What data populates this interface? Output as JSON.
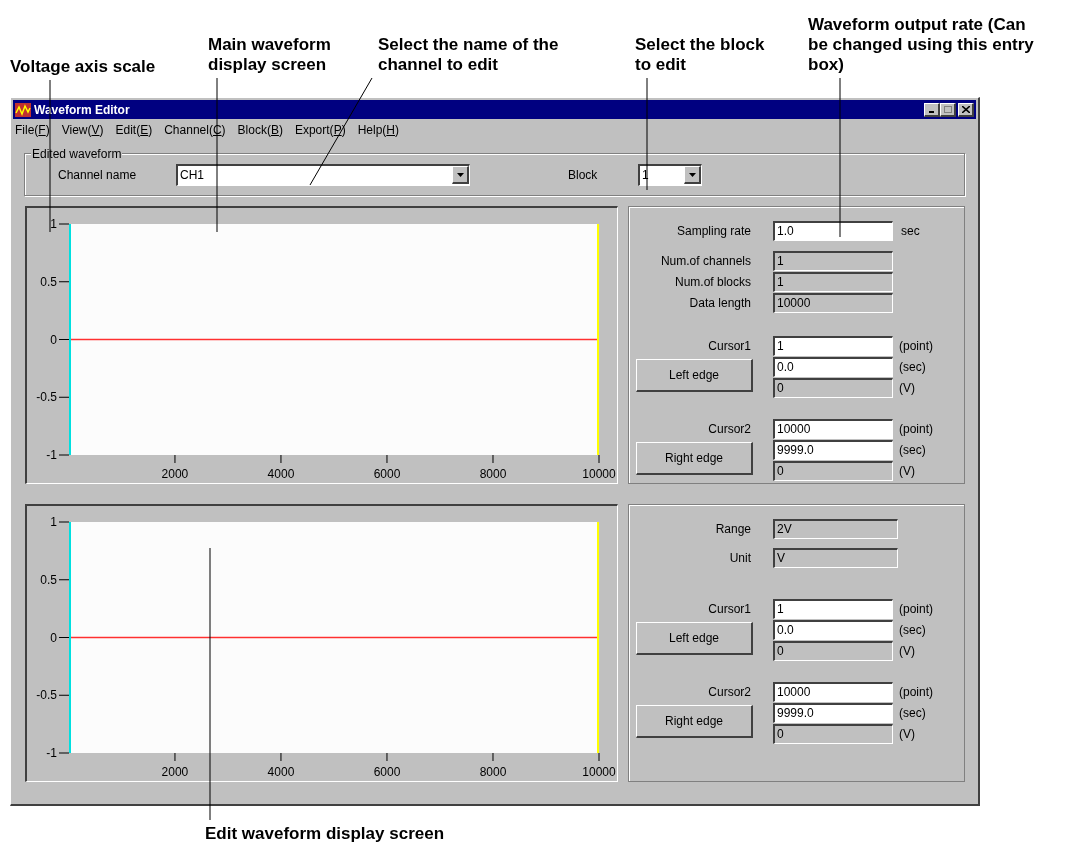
{
  "callouts": [
    {
      "text": "Voltage axis scale"
    },
    {
      "text": "Main waveform display screen"
    },
    {
      "text": "Select the name of the channel to edit"
    },
    {
      "text": "Select the block to edit"
    },
    {
      "text": "Waveform output rate (Can be changed using this entry box)"
    },
    {
      "text": "Edit waveform display screen"
    }
  ],
  "window": {
    "title": "Waveform Editor"
  },
  "menu": [
    "File(F)",
    "View(V)",
    "Edit(E)",
    "Channel(C)",
    "Block(B)",
    "Export(P)",
    "Help(H)"
  ],
  "edited_waveform": {
    "title": "Edited waveform",
    "channel_label": "Channel name",
    "channel_value": "CH1",
    "block_label": "Block",
    "block_value": "1"
  },
  "main_plot": {
    "chart_data": {
      "type": "line",
      "x": [
        1,
        10000
      ],
      "series": [
        {
          "color": "#ff3030",
          "values": [
            0,
            0
          ]
        }
      ],
      "xlim": [
        1,
        10000
      ],
      "ylim": [
        -1,
        1
      ],
      "xticks": [
        2000,
        4000,
        6000,
        8000,
        10000
      ],
      "yticks": [
        -1,
        -0.5,
        0,
        0.5,
        1
      ]
    }
  },
  "main_info": {
    "fields": [
      {
        "label": "Sampling rate",
        "value": "1.0",
        "unit": "sec",
        "disabled": false
      },
      {
        "label": "Num.of channels",
        "value": "1",
        "disabled": true
      },
      {
        "label": "Num.of blocks",
        "value": "1",
        "disabled": true
      },
      {
        "label": "Data length",
        "value": "10000",
        "disabled": true
      }
    ],
    "cursors": [
      {
        "label": "Cursor1",
        "button": "Left edge",
        "fields": [
          {
            "value": "1",
            "unit": "(point)",
            "disabled": false
          },
          {
            "value": "0.0",
            "unit": "(sec)",
            "disabled": false
          },
          {
            "value": "0",
            "unit": "(V)",
            "disabled": true
          }
        ]
      },
      {
        "label": "Cursor2",
        "button": "Right edge",
        "fields": [
          {
            "value": "10000",
            "unit": "(point)",
            "disabled": false
          },
          {
            "value": "9999.0",
            "unit": "(sec)",
            "disabled": false
          },
          {
            "value": "0",
            "unit": "(V)",
            "disabled": true
          }
        ]
      }
    ]
  },
  "edit_plot": {
    "chart_data": {
      "type": "line",
      "x": [
        1,
        10000
      ],
      "series": [
        {
          "color": "#ff3030",
          "values": [
            0,
            0
          ]
        }
      ],
      "xlim": [
        1,
        10000
      ],
      "ylim": [
        -1,
        1
      ],
      "xticks": [
        2000,
        4000,
        6000,
        8000,
        10000
      ],
      "yticks": [
        -1,
        -0.5,
        0,
        0.5,
        1
      ]
    }
  },
  "edit_info": {
    "fields": [
      {
        "label": "Range",
        "value": "2V",
        "disabled": true
      },
      {
        "label": "Unit",
        "value": "V",
        "disabled": true
      }
    ],
    "cursors": [
      {
        "label": "Cursor1",
        "button": "Left edge",
        "fields": [
          {
            "value": "1",
            "unit": "(point)",
            "disabled": false
          },
          {
            "value": "0.0",
            "unit": "(sec)",
            "disabled": false
          },
          {
            "value": "0",
            "unit": "(V)",
            "disabled": true
          }
        ]
      },
      {
        "label": "Cursor2",
        "button": "Right edge",
        "fields": [
          {
            "value": "10000",
            "unit": "(point)",
            "disabled": false
          },
          {
            "value": "9999.0",
            "unit": "(sec)",
            "disabled": false
          },
          {
            "value": "0",
            "unit": "(V)",
            "disabled": true
          }
        ]
      }
    ]
  }
}
